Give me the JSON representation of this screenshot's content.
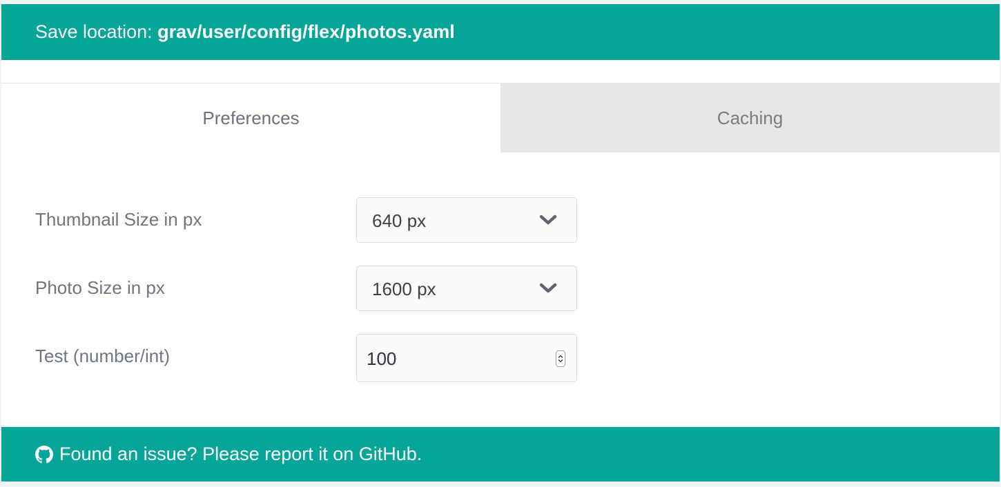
{
  "header": {
    "save_label": "Save location: ",
    "save_path": "grav/user/config/flex/photos.yaml",
    "background": "#06a599"
  },
  "tabs": [
    {
      "label": "Preferences",
      "active": true
    },
    {
      "label": "Caching",
      "active": false
    }
  ],
  "form": {
    "fields": [
      {
        "label": "Thumbnail Size in px",
        "value": "640 px",
        "control": "select"
      },
      {
        "label": "Photo Size in px",
        "value": "1600 px",
        "control": "select"
      },
      {
        "label": "Test (number/int)",
        "value": "100",
        "control": "number"
      }
    ]
  },
  "footer": {
    "icon": "github-icon",
    "text": "Found an issue? Please report it on GitHub.",
    "background": "#06a599"
  }
}
